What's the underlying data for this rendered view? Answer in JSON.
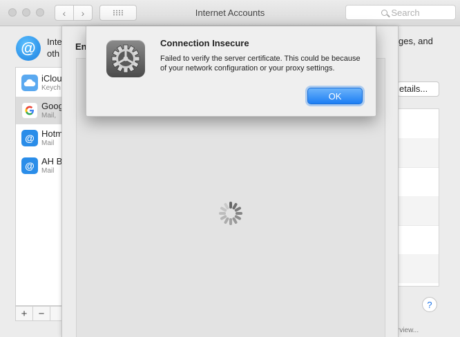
{
  "window": {
    "title": "Internet Accounts"
  },
  "toolbar": {
    "back_glyph": "‹",
    "forward_glyph": "›"
  },
  "search": {
    "placeholder": "Search"
  },
  "intro": {
    "line1": "Inte",
    "line2": "oth",
    "right_fragment": "ges, and"
  },
  "accounts": [
    {
      "name": "iClou",
      "subtitle": "Keych",
      "icon": "icloud-icon",
      "color": "#5aa9f0",
      "selected": false
    },
    {
      "name": "Goog",
      "subtitle": "Mail,",
      "icon": "google-icon",
      "color": "#ffffff",
      "selected": true
    },
    {
      "name": "Hotm",
      "subtitle": "Mail",
      "icon": "at-icon",
      "color": "#2a8de9",
      "selected": false
    },
    {
      "name": "AH B",
      "subtitle": "Mail",
      "icon": "at-icon",
      "color": "#2a8de9",
      "selected": false
    }
  ],
  "list_controls": {
    "add": "+",
    "remove": "−"
  },
  "sheet": {
    "heading_fragment": "En"
  },
  "details_button": {
    "label": "etails..."
  },
  "help": {
    "label": "?"
  },
  "footer_fragment": "rview...",
  "alert": {
    "title": "Connection Insecure",
    "message": "Failed to verify the server certificate. This could be because of your network configuration or your proxy settings.",
    "ok_label": "OK",
    "icon": "gear-icon"
  },
  "app_icon_glyph": "@",
  "colors": {
    "accent": "#1c7ef4",
    "app_icon": "#1a7fe0"
  }
}
